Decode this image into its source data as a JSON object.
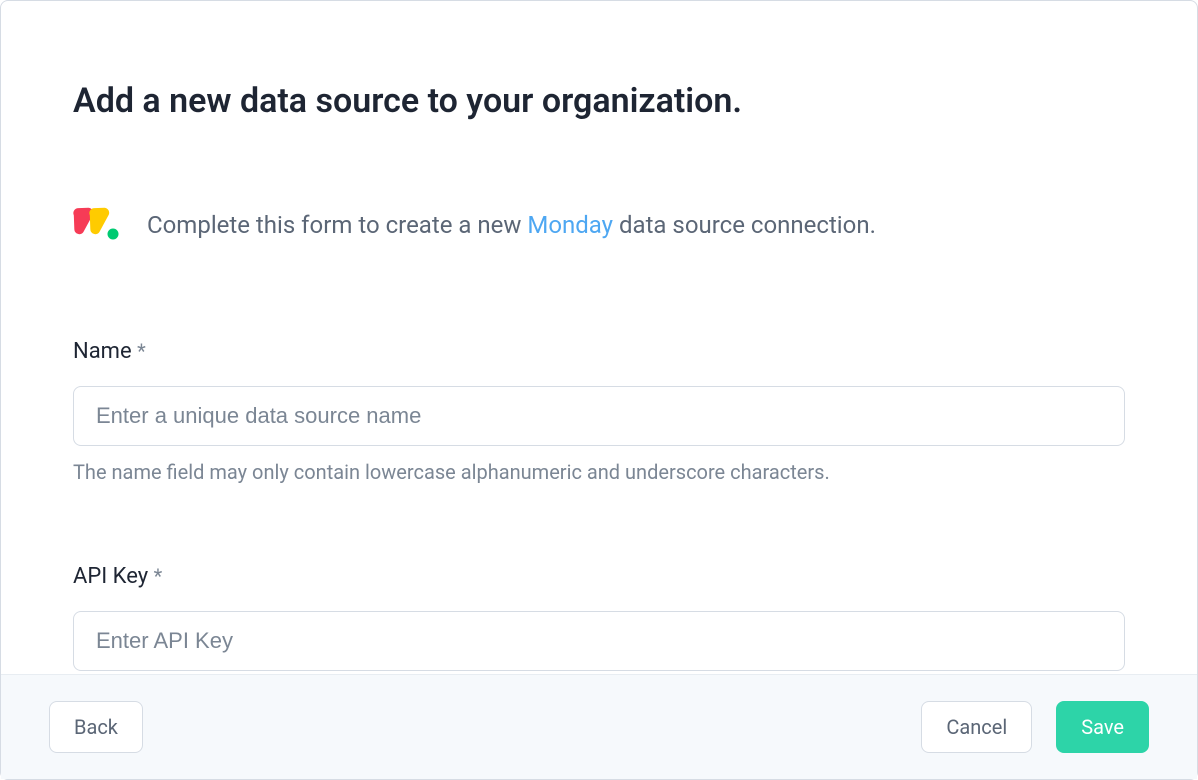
{
  "header": {
    "title": "Add a new data source to your organization."
  },
  "intro": {
    "text_before": "Complete this form to create a new ",
    "link_text": "Monday",
    "text_after": " data source connection.",
    "icon_name": "monday-logo"
  },
  "form": {
    "name": {
      "label": "Name",
      "required_indicator": "*",
      "placeholder": "Enter a unique data source name",
      "value": "",
      "help": "The name field may only contain lowercase alphanumeric and underscore characters."
    },
    "api_key": {
      "label": "API Key",
      "required_indicator": "*",
      "placeholder": "Enter API Key",
      "value": ""
    }
  },
  "footer": {
    "back_label": "Back",
    "cancel_label": "Cancel",
    "save_label": "Save"
  }
}
